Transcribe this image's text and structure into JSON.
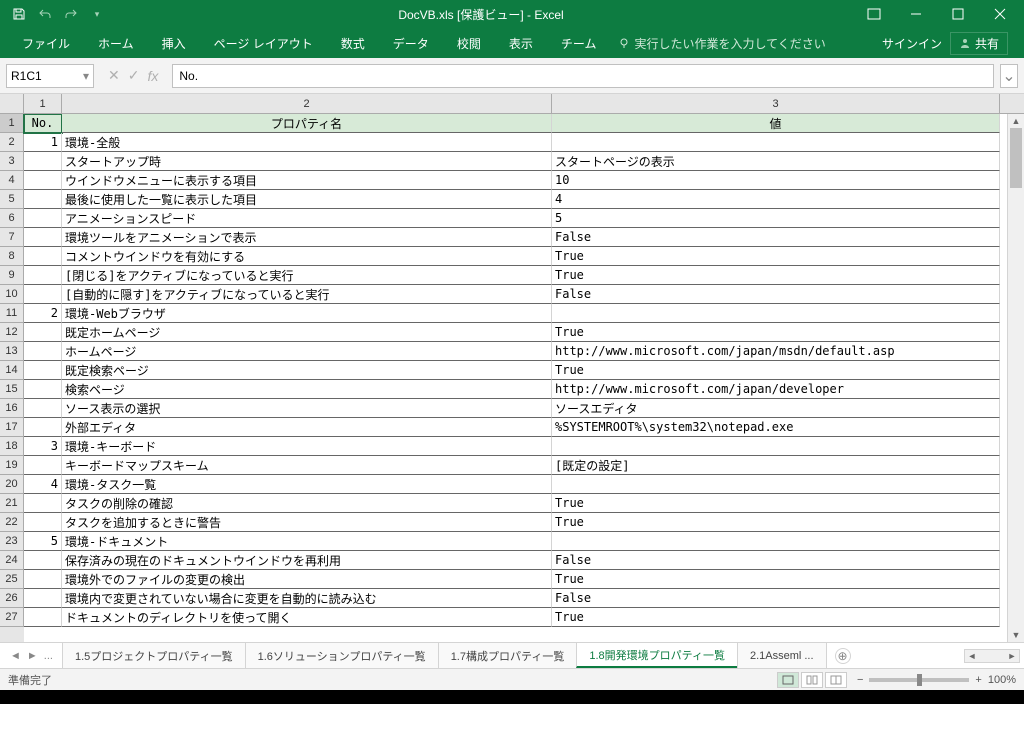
{
  "window": {
    "title": "DocVB.xls  [保護ビュー] - Excel",
    "ribbonRestore": "▢",
    "minimize": "—",
    "maximize": "▢",
    "close": "✕"
  },
  "ribbon": {
    "tabs": [
      "ファイル",
      "ホーム",
      "挿入",
      "ページ レイアウト",
      "数式",
      "データ",
      "校閲",
      "表示",
      "チーム"
    ],
    "tellMe": "実行したい作業を入力してください",
    "signIn": "サインイン",
    "share": "共有"
  },
  "formulaBar": {
    "nameBox": "R1C1",
    "cancel": "✕",
    "enter": "✓",
    "fx": "fx",
    "value": "No."
  },
  "grid": {
    "colHeaders": [
      "1",
      "2",
      "3"
    ],
    "headerRow": {
      "c1": "No.",
      "c2": "プロパティ名",
      "c3": "値"
    },
    "rows": [
      {
        "n": "2",
        "c1": "1",
        "c2": "環境-全般",
        "c3": ""
      },
      {
        "n": "3",
        "c1": "",
        "c2": "スタートアップ時",
        "c3": "スタートページの表示"
      },
      {
        "n": "4",
        "c1": "",
        "c2": "ウインドウメニューに表示する項目",
        "c3": "10"
      },
      {
        "n": "5",
        "c1": "",
        "c2": "最後に使用した一覧に表示した項目",
        "c3": "4"
      },
      {
        "n": "6",
        "c1": "",
        "c2": "アニメーションスピード",
        "c3": "5"
      },
      {
        "n": "7",
        "c1": "",
        "c2": "環境ツールをアニメーションで表示",
        "c3": "False"
      },
      {
        "n": "8",
        "c1": "",
        "c2": "コメントウインドウを有効にする",
        "c3": "True"
      },
      {
        "n": "9",
        "c1": "",
        "c2": "[閉じる]をアクティブになっていると実行",
        "c3": "True"
      },
      {
        "n": "10",
        "c1": "",
        "c2": "[自動的に隠す]をアクティブになっていると実行",
        "c3": "False"
      },
      {
        "n": "11",
        "c1": "2",
        "c2": "環境-Webブラウザ",
        "c3": ""
      },
      {
        "n": "12",
        "c1": "",
        "c2": "既定ホームページ",
        "c3": "True"
      },
      {
        "n": "13",
        "c1": "",
        "c2": "ホームページ",
        "c3": "http://www.microsoft.com/japan/msdn/default.asp"
      },
      {
        "n": "14",
        "c1": "",
        "c2": "既定検索ページ",
        "c3": "True"
      },
      {
        "n": "15",
        "c1": "",
        "c2": "検索ページ",
        "c3": "http://www.microsoft.com/japan/developer"
      },
      {
        "n": "16",
        "c1": "",
        "c2": "ソース表示の選択",
        "c3": "ソースエディタ"
      },
      {
        "n": "17",
        "c1": "",
        "c2": "外部エディタ",
        "c3": "%SYSTEMROOT%\\system32\\notepad.exe"
      },
      {
        "n": "18",
        "c1": "3",
        "c2": "環境-キーボード",
        "c3": ""
      },
      {
        "n": "19",
        "c1": "",
        "c2": "キーボードマップスキーム",
        "c3": "[既定の設定]"
      },
      {
        "n": "20",
        "c1": "4",
        "c2": "環境-タスク一覧",
        "c3": ""
      },
      {
        "n": "21",
        "c1": "",
        "c2": "タスクの削除の確認",
        "c3": "True"
      },
      {
        "n": "22",
        "c1": "",
        "c2": "タスクを追加するときに警告",
        "c3": "True"
      },
      {
        "n": "23",
        "c1": "5",
        "c2": "環境-ドキュメント",
        "c3": ""
      },
      {
        "n": "24",
        "c1": "",
        "c2": "保存済みの現在のドキュメントウインドウを再利用",
        "c3": "False"
      },
      {
        "n": "25",
        "c1": "",
        "c2": "環境外でのファイルの変更の検出",
        "c3": "True"
      },
      {
        "n": "26",
        "c1": "",
        "c2": "環境内で変更されていない場合に変更を自動的に読み込む",
        "c3": "False"
      },
      {
        "n": "27",
        "c1": "",
        "c2": "ドキュメントのディレクトリを使って開く",
        "c3": "True"
      }
    ]
  },
  "sheets": {
    "nav": {
      "first": "◄",
      "last": "►",
      "more": "..."
    },
    "tabs": [
      {
        "label": "1.5プロジェクトプロパティ一覧",
        "active": false
      },
      {
        "label": "1.6ソリューションプロパティ一覧",
        "active": false
      },
      {
        "label": "1.7構成プロパティ一覧",
        "active": false
      },
      {
        "label": "1.8開発環境プロパティ一覧",
        "active": true
      },
      {
        "label": "2.1Asseml ...",
        "active": false
      }
    ],
    "newSheet": "⊕"
  },
  "status": {
    "ready": "準備完了",
    "zoomOut": "−",
    "zoomIn": "+",
    "zoom": "100%"
  }
}
